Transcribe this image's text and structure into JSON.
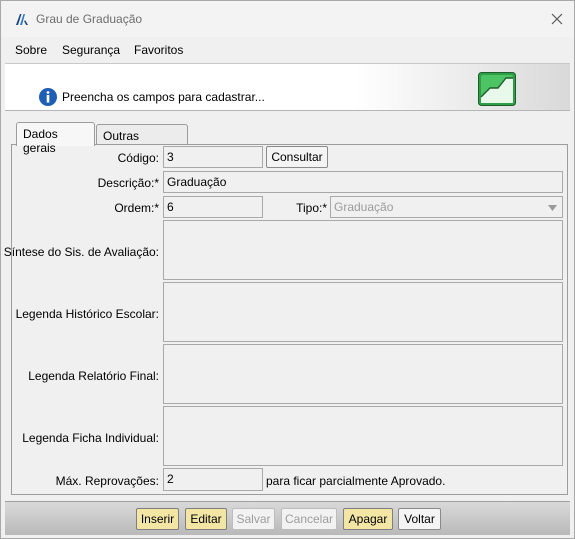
{
  "window": {
    "title": "Grau de Graduação"
  },
  "menu": {
    "items": [
      "Sobre",
      "Segurança",
      "Favoritos"
    ]
  },
  "banner": {
    "message": "Preencha os campos para cadastrar..."
  },
  "tabs": [
    {
      "label": "Dados gerais"
    },
    {
      "label": "Outras Opções"
    }
  ],
  "form": {
    "codigo": {
      "label": "Código:",
      "value": "3"
    },
    "consultar_label": "Consultar",
    "descricao": {
      "label": "Descrição:*",
      "value": "Graduação"
    },
    "ordem": {
      "label": "Ordem:*",
      "value": "6"
    },
    "tipo": {
      "label": "Tipo:*",
      "value": "Graduação"
    },
    "sintese": {
      "label": "Síntese do Sis. de Avaliação:",
      "value": ""
    },
    "leg_historico": {
      "label": "Legenda Histórico Escolar:",
      "value": ""
    },
    "leg_relatorio": {
      "label": "Legenda Relatório Final:",
      "value": ""
    },
    "leg_ficha": {
      "label": "Legenda Ficha Individual:",
      "value": ""
    },
    "max_reprov": {
      "label": "Máx. Reprovações:",
      "value": "2",
      "suffix": "para ficar parcialmente Aprovado."
    }
  },
  "buttons": {
    "inserir": "Inserir",
    "editar": "Editar",
    "salvar": "Salvar",
    "cancelar": "Cancelar",
    "apagar": "Apagar",
    "voltar": "Voltar"
  },
  "colors": {
    "gold_button": "#f3e6a5",
    "logo_green": "#2aa84a",
    "info_blue": "#1e5fb4"
  }
}
